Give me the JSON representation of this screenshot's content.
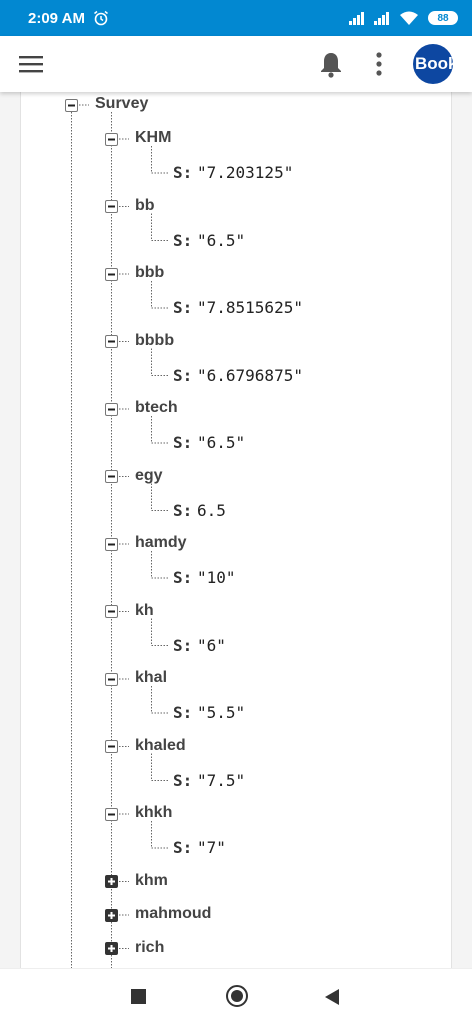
{
  "status": {
    "time": "2:09 AM",
    "battery": "88"
  },
  "appbar": {
    "avatar_text": "Book"
  },
  "colors": {
    "status_bar": "#0288d1",
    "avatar": "#0d47a1",
    "label": "#444444"
  },
  "tree": {
    "root_label": "Survey",
    "items": [
      {
        "key": "KHM",
        "expanded": true,
        "field": "S:",
        "value": "\"7.203125\""
      },
      {
        "key": "bb",
        "expanded": true,
        "field": "S:",
        "value": "\"6.5\""
      },
      {
        "key": "bbb",
        "expanded": true,
        "field": "S:",
        "value": "\"7.8515625\""
      },
      {
        "key": "bbbb",
        "expanded": true,
        "field": "S:",
        "value": "\"6.6796875\""
      },
      {
        "key": "btech",
        "expanded": true,
        "field": "S:",
        "value": "\"6.5\""
      },
      {
        "key": "egy",
        "expanded": true,
        "field": "S:",
        "value": "6.5"
      },
      {
        "key": "hamdy",
        "expanded": true,
        "field": "S:",
        "value": "\"10\""
      },
      {
        "key": "kh",
        "expanded": true,
        "field": "S:",
        "value": "\"6\""
      },
      {
        "key": "khal",
        "expanded": true,
        "field": "S:",
        "value": "\"5.5\""
      },
      {
        "key": "khaled",
        "expanded": true,
        "field": "S:",
        "value": "\"7.5\""
      },
      {
        "key": "khkh",
        "expanded": true,
        "field": "S:",
        "value": "\"7\""
      },
      {
        "key": "khm",
        "expanded": false
      },
      {
        "key": "mahmoud",
        "expanded": false
      },
      {
        "key": "rich",
        "expanded": false
      }
    ]
  }
}
